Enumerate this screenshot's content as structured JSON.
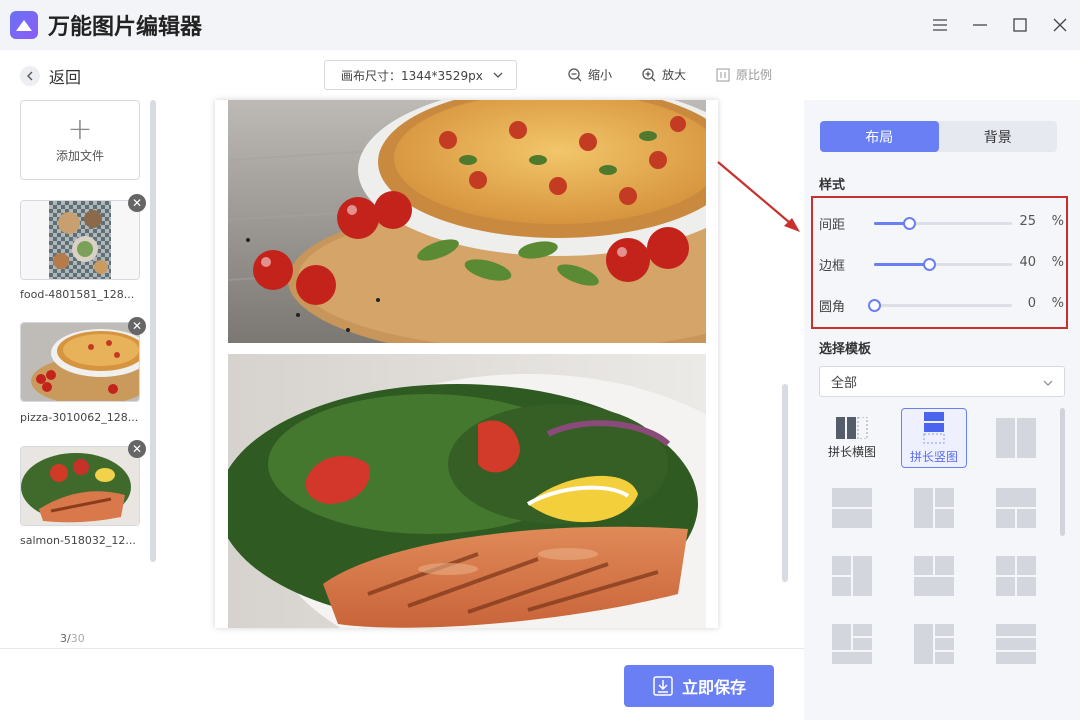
{
  "app": {
    "title": "万能图片编辑器"
  },
  "toolbar": {
    "back_label": "返回",
    "canvas_size_label": "画布尺寸：1344*3529px",
    "zoom_out_label": "缩小",
    "zoom_in_label": "放大",
    "original_ratio_label": "原比例"
  },
  "files": {
    "add_label": "添加文件",
    "items": [
      {
        "name": "food-4801581_128...",
        "icon": "food-photo"
      },
      {
        "name": "pizza-3010062_128...",
        "icon": "pizza-photo"
      },
      {
        "name": "salmon-518032_12...",
        "icon": "salmon-photo"
      }
    ],
    "page_current": "3/",
    "page_total": "30"
  },
  "footer": {
    "save_label": "立即保存"
  },
  "panel": {
    "tabs": [
      {
        "label": "布局",
        "active": true
      },
      {
        "label": "背景",
        "active": false
      }
    ],
    "style_title": "样式",
    "sliders": [
      {
        "label": "间距",
        "value": "25",
        "unit": "%",
        "fraction": 0.25
      },
      {
        "label": "边框",
        "value": "40",
        "unit": "%",
        "fraction": 0.4
      },
      {
        "label": "圆角",
        "value": "0",
        "unit": "%",
        "fraction": 0.0
      }
    ],
    "template_title": "选择模板",
    "template_filter": "全部",
    "templates": [
      {
        "label": "拼长横图",
        "icon": "horizontal-stitch-icon",
        "selected": false
      },
      {
        "label": "拼长竖图",
        "icon": "vertical-stitch-icon",
        "selected": true
      }
    ]
  },
  "colors": {
    "accent": "#6b7ff5",
    "highlight_box": "#c7302c",
    "panel_bg": "#f4f6fa",
    "titlebar_bg": "#f2f4f8"
  }
}
